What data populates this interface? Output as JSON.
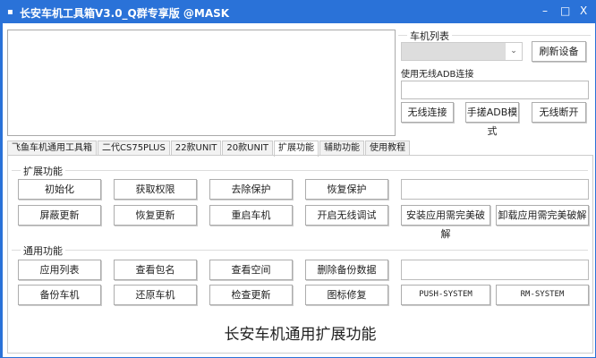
{
  "window": {
    "title": "长安车机工具箱V3.0_Q群专享版 @MASK",
    "minimize": "–",
    "maximize": "□",
    "close": "X"
  },
  "device": {
    "group_label": "车机列表",
    "selected": "",
    "refresh": "刷新设备",
    "wireless_label": "使用无线ADB连接",
    "ip_value": "",
    "connect": "无线连接",
    "manual_adb": "手搓ADB模式",
    "disconnect": "无线断开"
  },
  "tabs": [
    {
      "label": "飞鱼车机通用工具箱"
    },
    {
      "label": "二代CS75PLUS"
    },
    {
      "label": "22款UNIT"
    },
    {
      "label": "20款UNIT"
    },
    {
      "label": "扩展功能",
      "active": true
    },
    {
      "label": "辅助功能"
    },
    {
      "label": "使用教程"
    }
  ],
  "extend": {
    "label": "扩展功能",
    "row1": [
      "初始化",
      "获取权限",
      "去除保护",
      "恢复保护"
    ],
    "row2": [
      "屏蔽更新",
      "恢复更新",
      "重启车机",
      "开启无线调试",
      "安装应用需完美破解",
      "卸载应用需完美破解"
    ]
  },
  "general": {
    "label": "通用功能",
    "row1": [
      "应用列表",
      "查看包名",
      "查看空间",
      "删除备份数据"
    ],
    "row2": [
      "备份车机",
      "还原车机",
      "检查更新",
      "图标修复",
      "PUSH-SYSTEM",
      "RM-SYSTEM"
    ]
  },
  "footer": "长安车机通用扩展功能"
}
